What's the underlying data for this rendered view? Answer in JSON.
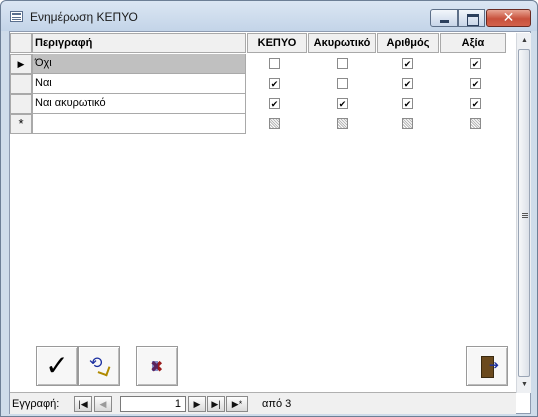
{
  "window": {
    "title": "Ενημέρωση ΚΕΠΥΟ"
  },
  "columns": [
    {
      "key": "desc",
      "label": "Περιγραφή"
    },
    {
      "key": "kepyo",
      "label": "ΚΕΠΥΟ"
    },
    {
      "key": "akyrotiko",
      "label": "Ακυρωτικό"
    },
    {
      "key": "arithmos",
      "label": "Αριθμός"
    },
    {
      "key": "axia",
      "label": "Αξία"
    }
  ],
  "rows": [
    {
      "desc": "Όχι",
      "kepyo": false,
      "akyrotiko": false,
      "arithmos": true,
      "axia": true,
      "current": true
    },
    {
      "desc": "Ναι",
      "kepyo": true,
      "akyrotiko": false,
      "arithmos": true,
      "axia": true
    },
    {
      "desc": "Ναι ακυρωτικό",
      "kepyo": true,
      "akyrotiko": true,
      "arithmos": true,
      "axia": true
    }
  ],
  "new_row_marker": "*",
  "navigation": {
    "label": "Εγγραφή:",
    "current_record": "1",
    "of_text": "από  3"
  },
  "buttons": {
    "ok": "✓"
  }
}
